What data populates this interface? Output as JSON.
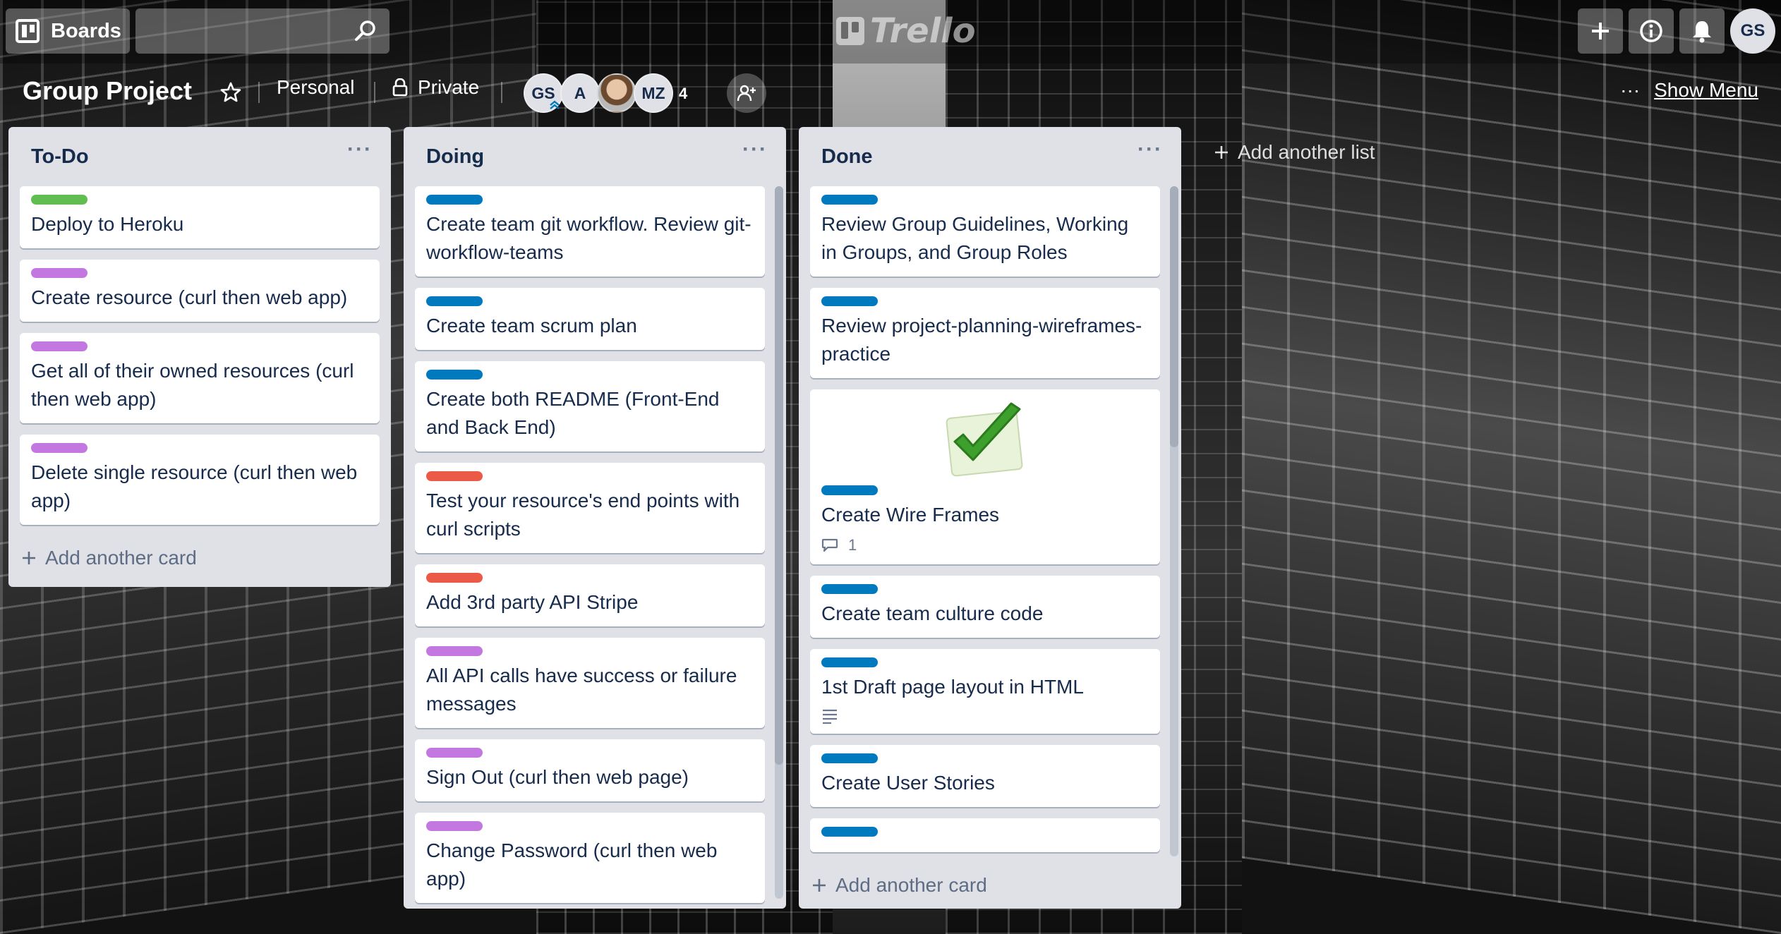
{
  "header": {
    "boards_label": "Boards",
    "search_placeholder": "",
    "logo_text": "Trello",
    "user_initials": "GS"
  },
  "board": {
    "title": "Group Project",
    "team_label": "Personal",
    "visibility_label": "Private",
    "members": [
      "GS",
      "A",
      "",
      "MZ"
    ],
    "member_overflow": "4",
    "menu_label": "Show Menu"
  },
  "colors": {
    "green": "#61bd4f",
    "purple": "#c377e0",
    "blue": "#0079bf",
    "red": "#eb5a46"
  },
  "lists": [
    {
      "title": "To-Do",
      "add_card_label": "Add another card",
      "cards": [
        {
          "label": "green",
          "text": "Deploy to Heroku"
        },
        {
          "label": "purple",
          "text": "Create resource (curl then web app)"
        },
        {
          "label": "purple",
          "text": "Get all of their owned resources (curl then web app)"
        },
        {
          "label": "purple",
          "text": "Delete single resource (curl then web app)"
        }
      ]
    },
    {
      "title": "Doing",
      "add_card_label": "",
      "cards": [
        {
          "label": "blue",
          "text": "Create team git workflow. Review git-workflow-teams"
        },
        {
          "label": "blue",
          "text": "Create team scrum plan"
        },
        {
          "label": "blue",
          "text": "Create both README (Front-End and Back End)"
        },
        {
          "label": "red",
          "text": "Test your resource's end points with curl scripts"
        },
        {
          "label": "red",
          "text": "Add 3rd party API Stripe"
        },
        {
          "label": "purple",
          "text": "All API calls have success or failure messages"
        },
        {
          "label": "purple",
          "text": "Sign Out (curl then web page)"
        },
        {
          "label": "purple",
          "text": "Change Password (curl then web app)"
        }
      ]
    },
    {
      "title": "Done",
      "add_card_label": "Add another card",
      "cards": [
        {
          "label": "blue",
          "text": "Review Group Guidelines, Working in Groups, and Group Roles"
        },
        {
          "label": "blue",
          "text": "Review project-planning-wireframes-practice"
        },
        {
          "label": "blue",
          "text": "Create Wire Frames",
          "cover": "checkmark",
          "comments": "1"
        },
        {
          "label": "blue",
          "text": "Create team culture code"
        },
        {
          "label": "blue",
          "text": "1st Draft page layout in HTML",
          "description": true
        },
        {
          "label": "blue",
          "text": "Create User Stories"
        },
        {
          "label": "blue",
          "text": ""
        }
      ]
    }
  ],
  "add_list_label": "Add another list"
}
